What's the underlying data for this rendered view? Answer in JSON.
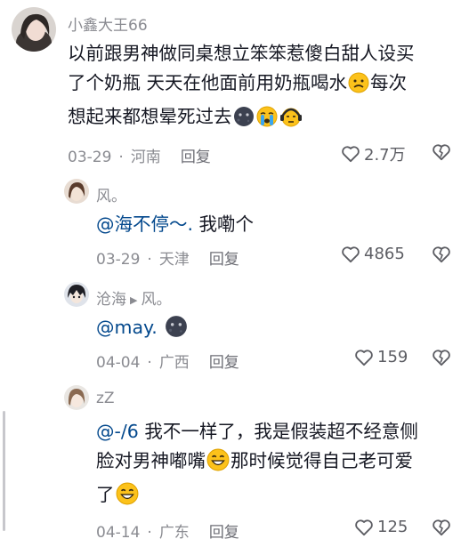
{
  "comments": [
    {
      "username": "小鑫大王66",
      "text_parts": [
        "以前跟男神做同桌想立笨笨惹傻白甜人设买",
        "了个奶瓶 天天在他面前用奶瓶喝水",
        "每次",
        "想起来都想晕死过去"
      ],
      "emojis": [
        "confused-face",
        "dark-moon-face",
        "crying-face",
        "headphone-face"
      ],
      "date": "03-29",
      "location": "河南",
      "reply_label": "回复",
      "likes": "2.7万"
    },
    {
      "username": "风。",
      "mention": "@海不停～.",
      "text": " 我嘞个",
      "date": "03-29",
      "location": "天津",
      "reply_label": "回复",
      "likes": "4865"
    },
    {
      "username": "沧海",
      "reply_to": "风。",
      "mention": "@may.",
      "emojis": [
        "dark-moon-face"
      ],
      "date": "04-04",
      "location": "广西",
      "reply_label": "回复",
      "likes": "159"
    },
    {
      "username": "zZ",
      "mention": "@-/6",
      "text_parts": [
        " 我不一样了，我是假装超不经意侧",
        "脸对男神嘟嘴",
        "那时候觉得自己老可爱",
        "了"
      ],
      "emojis": [
        "grin-face",
        "grin-face"
      ],
      "date": "04-14",
      "location": "广东",
      "reply_label": "回复",
      "likes": "125"
    }
  ]
}
